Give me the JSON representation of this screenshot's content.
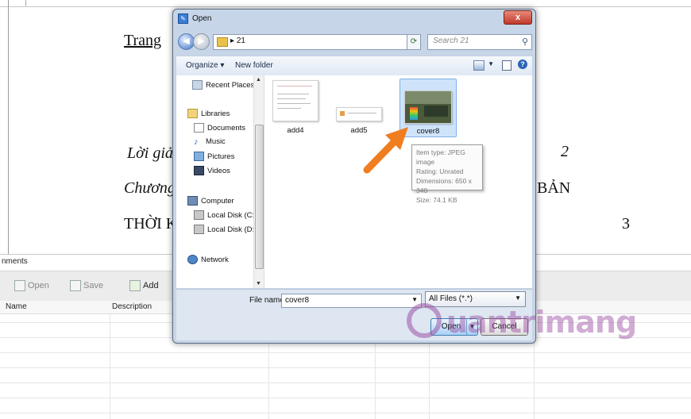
{
  "document": {
    "heading": "Trang",
    "line1": "Lời giả",
    "line2": "Chương",
    "line3": "THỜI K",
    "page_no_1": "2",
    "right_text": "BẢN",
    "page_no_2": "3"
  },
  "attachments_panel": {
    "title": "nments",
    "toolbar": {
      "open_label": "Open",
      "save_label": "Save",
      "add_label": "Add"
    },
    "columns": [
      "Name",
      "Description"
    ]
  },
  "dialog": {
    "title": "Open",
    "close_label": "x",
    "breadcrumb": "21",
    "search_placeholder": "Search 21",
    "organize_label": "Organize ▾",
    "new_folder_label": "New folder",
    "nav": {
      "recent_places": "Recent Places",
      "libraries": "Libraries",
      "documents": "Documents",
      "music": "Music",
      "pictures": "Pictures",
      "videos": "Videos",
      "computer": "Computer",
      "local_c": "Local Disk (C:)",
      "local_d": "Local Disk (D:)",
      "network": "Network"
    },
    "files": [
      {
        "name": "add4"
      },
      {
        "name": "add5"
      },
      {
        "name": "cover8",
        "selected": true
      }
    ],
    "tooltip": {
      "item_type": "Item type: JPEG image",
      "rating": "Rating: Unrated",
      "dimensions": "Dimensions: 650 x 340",
      "size": "Size: 74.1 KB"
    },
    "file_name_label": "File name:",
    "file_name_value": "cover8",
    "file_type_value": "All Files (*.*)",
    "open_button": "Open",
    "cancel_button": "Cancel"
  },
  "watermark": "uantrimang",
  "colors": {
    "arrow": "#f07d20",
    "watermark": "#9646a0",
    "selection": "#cfe4fb"
  }
}
